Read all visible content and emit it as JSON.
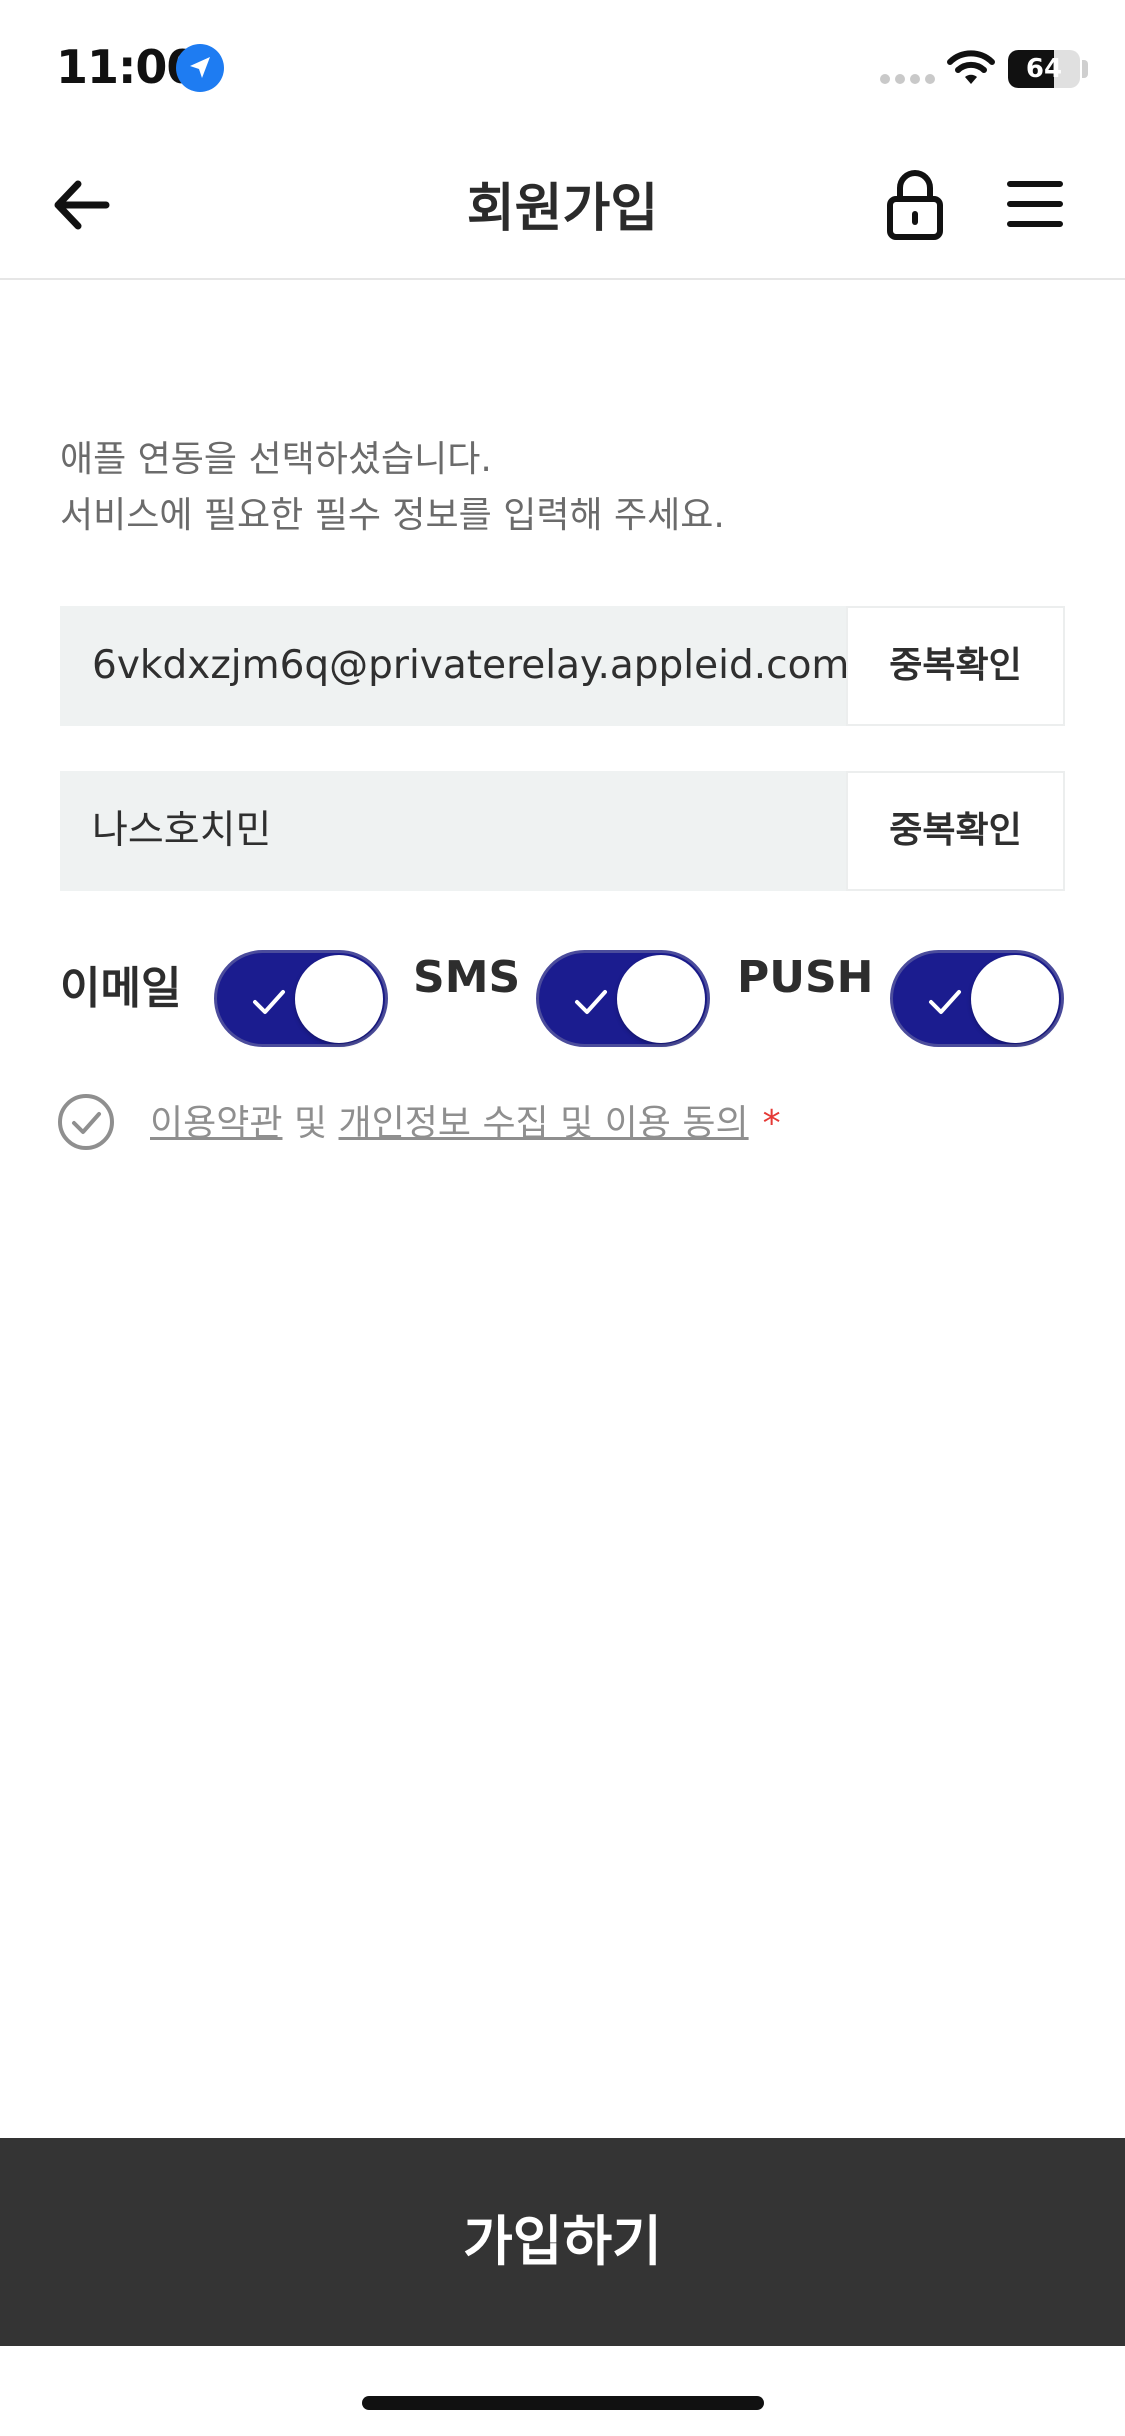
{
  "status_bar": {
    "time": "11:00",
    "battery_percent": "64",
    "battery_level": 0.64,
    "icons": [
      "location-arrow-icon",
      "signal-dots-icon",
      "wifi-icon",
      "battery-icon"
    ]
  },
  "header": {
    "title": "회원가입",
    "icons": [
      "arrow-left-icon",
      "lock-icon",
      "hamburger-menu-icon"
    ]
  },
  "description": {
    "line1": "애플 연동을 선택하셨습니다.",
    "line2": "서비스에 필요한 필수 정보를 입력해 주세요."
  },
  "email_field": {
    "value": "6vkdxzjm6q@privaterelay.appleid.com",
    "button_label": "중복확인"
  },
  "nickname_field": {
    "value": "나스호치민",
    "button_label": "중복확인"
  },
  "notifications": {
    "email": {
      "label": "이메일",
      "on": true
    },
    "sms": {
      "label": "SMS",
      "on": true
    },
    "push": {
      "label": "PUSH",
      "on": true
    }
  },
  "agreement": {
    "terms_link": "이용약관",
    "connector": "및",
    "privacy_link": "개인정보 수집 및 이용 동의",
    "required_mark": "*"
  },
  "submit": {
    "label": "가입하기"
  },
  "colors": {
    "toggle_on": "#1b1c8f",
    "input_bg": "#eff2f2",
    "submit_bg": "#343434",
    "required": "#e53935",
    "location_blue": "#1e7cf2"
  }
}
